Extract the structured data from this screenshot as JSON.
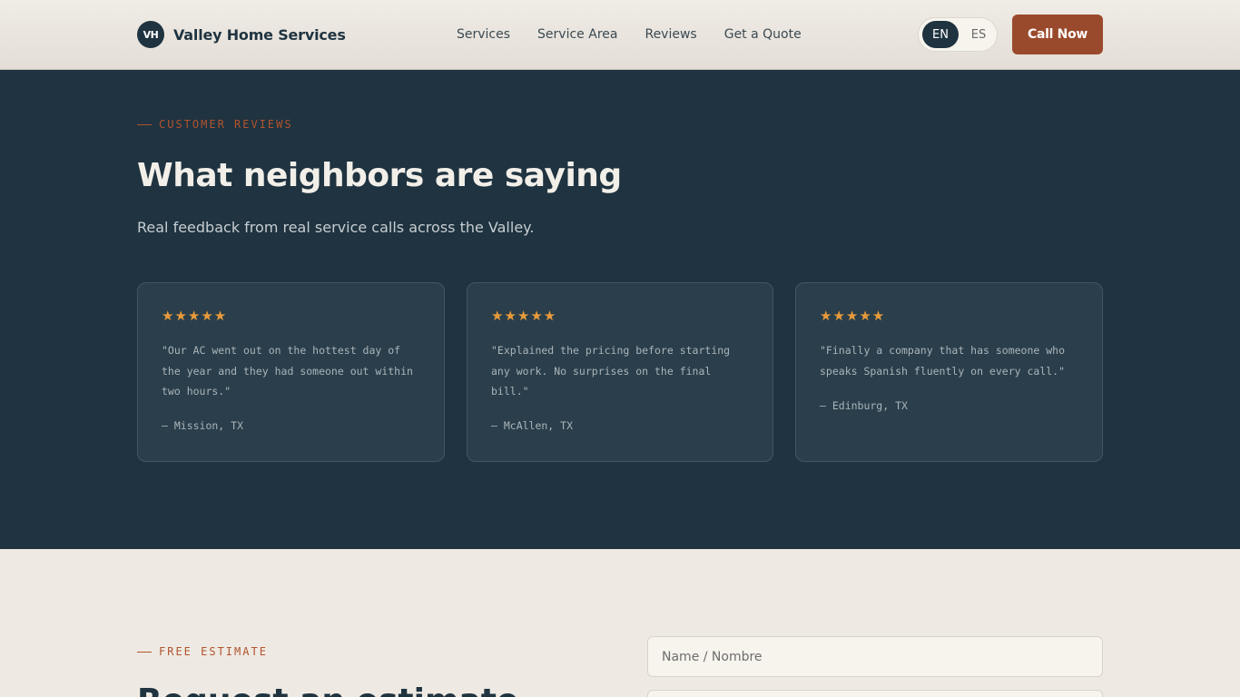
{
  "header": {
    "logo_initials": "VH",
    "brand_name": "Valley Home Services",
    "nav": [
      "Services",
      "Service Area",
      "Reviews",
      "Get a Quote"
    ],
    "lang_en": "EN",
    "lang_es": "ES",
    "cta": "Call Now"
  },
  "reviews": {
    "eyebrow": "CUSTOMER REVIEWS",
    "title": "What neighbors are saying",
    "subtitle": "Real feedback from real service calls across the Valley.",
    "rating_max": 5,
    "cards": [
      {
        "stars": "★★★★★",
        "rating": 5,
        "quote": "\"Our AC went out on the hottest day of the year and they had someone out within two hours.\"",
        "author": "— Mission, TX"
      },
      {
        "stars": "★★★★★",
        "rating": 5,
        "quote": "\"Explained the pricing before starting any work. No surprises on the final bill.\"",
        "author": "— McAllen, TX"
      },
      {
        "stars": "★★★★★",
        "rating": 5,
        "quote": "\"Finally a company that has someone who speaks Spanish fluently on every call.\"",
        "author": "— Edinburg, TX"
      }
    ]
  },
  "estimate": {
    "eyebrow": "FREE ESTIMATE",
    "title": "Request an estimate",
    "name_placeholder": "Name / Nombre"
  },
  "colors": {
    "accent": "#9a4a2c",
    "dark": "#1f3340",
    "star": "#e89a3a",
    "cream": "#eeeae3"
  }
}
